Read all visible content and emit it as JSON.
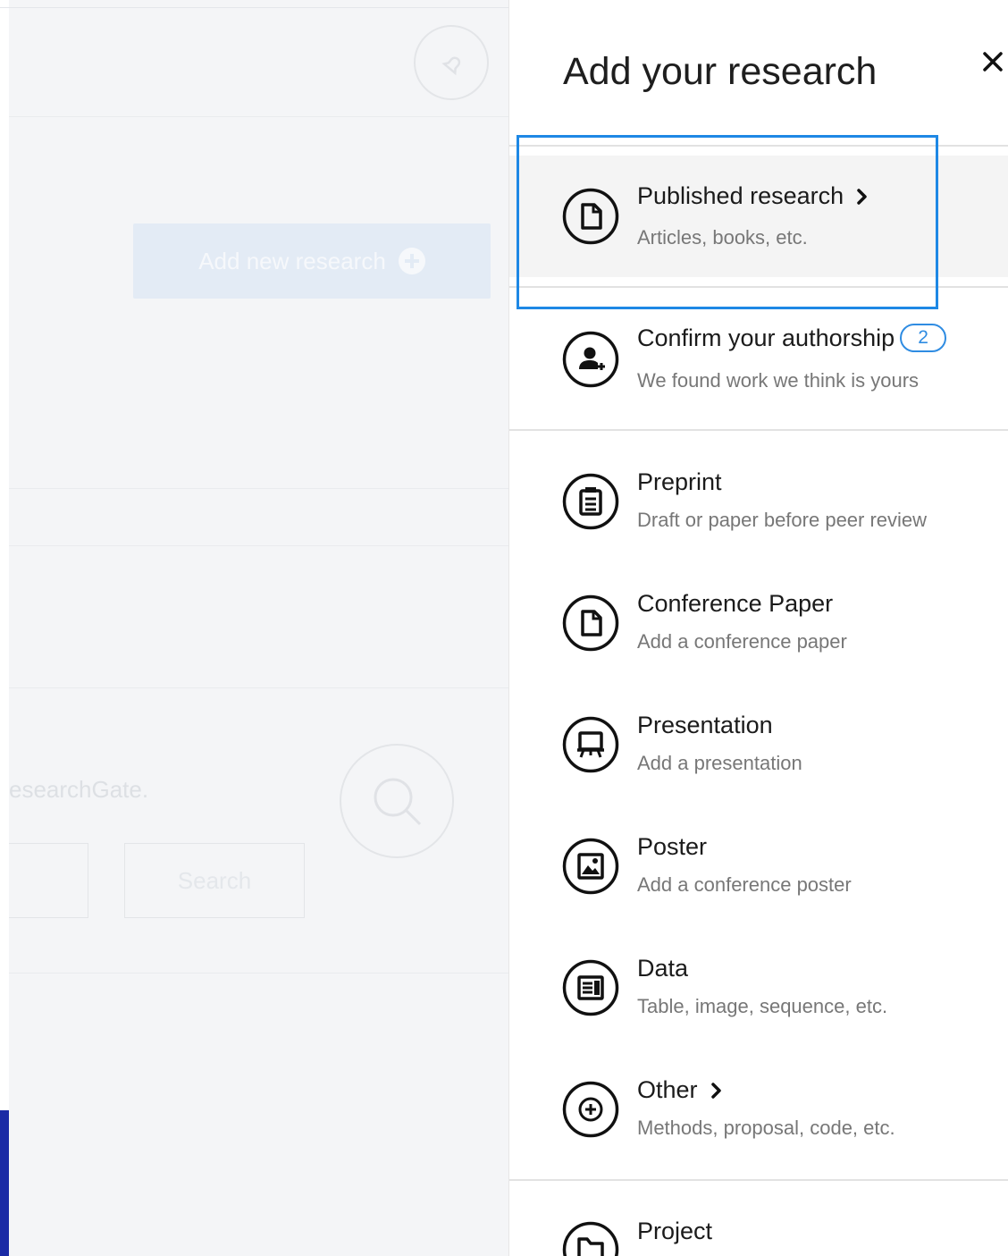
{
  "background_page": {
    "add_new_research_label": "Add new research",
    "network_text": "esearchGate.",
    "search_button_label": "Search"
  },
  "panel": {
    "title": "Add your research",
    "items": [
      {
        "title": "Published research",
        "subtitle": "Articles, books, etc.",
        "icon": "document-icon",
        "has_chevron": true,
        "selected": true
      },
      {
        "title": "Confirm your authorship",
        "subtitle": "We found work we think is yours",
        "icon": "add-person-icon",
        "badge": "2"
      },
      {
        "title": "Preprint",
        "subtitle": "Draft or paper before peer review",
        "icon": "clipboard-icon"
      },
      {
        "title": "Conference Paper",
        "subtitle": "Add a conference paper",
        "icon": "document-icon"
      },
      {
        "title": "Presentation",
        "subtitle": "Add a presentation",
        "icon": "presentation-board-icon"
      },
      {
        "title": "Poster",
        "subtitle": "Add a conference poster",
        "icon": "image-poster-icon"
      },
      {
        "title": "Data",
        "subtitle": "Table, image, sequence, etc.",
        "icon": "data-table-icon"
      },
      {
        "title": "Other",
        "subtitle": "Methods, proposal, code, etc.",
        "icon": "plus-circle-icon",
        "has_chevron": true
      },
      {
        "title": "Project",
        "subtitle": "",
        "icon": "folder-icon"
      }
    ]
  },
  "colors": {
    "accent_blue": "#1e88e5",
    "badge_blue": "#2f8ce2",
    "highlight_bg": "#f4f4f4",
    "dim_overlay": "#f4f5f7"
  }
}
